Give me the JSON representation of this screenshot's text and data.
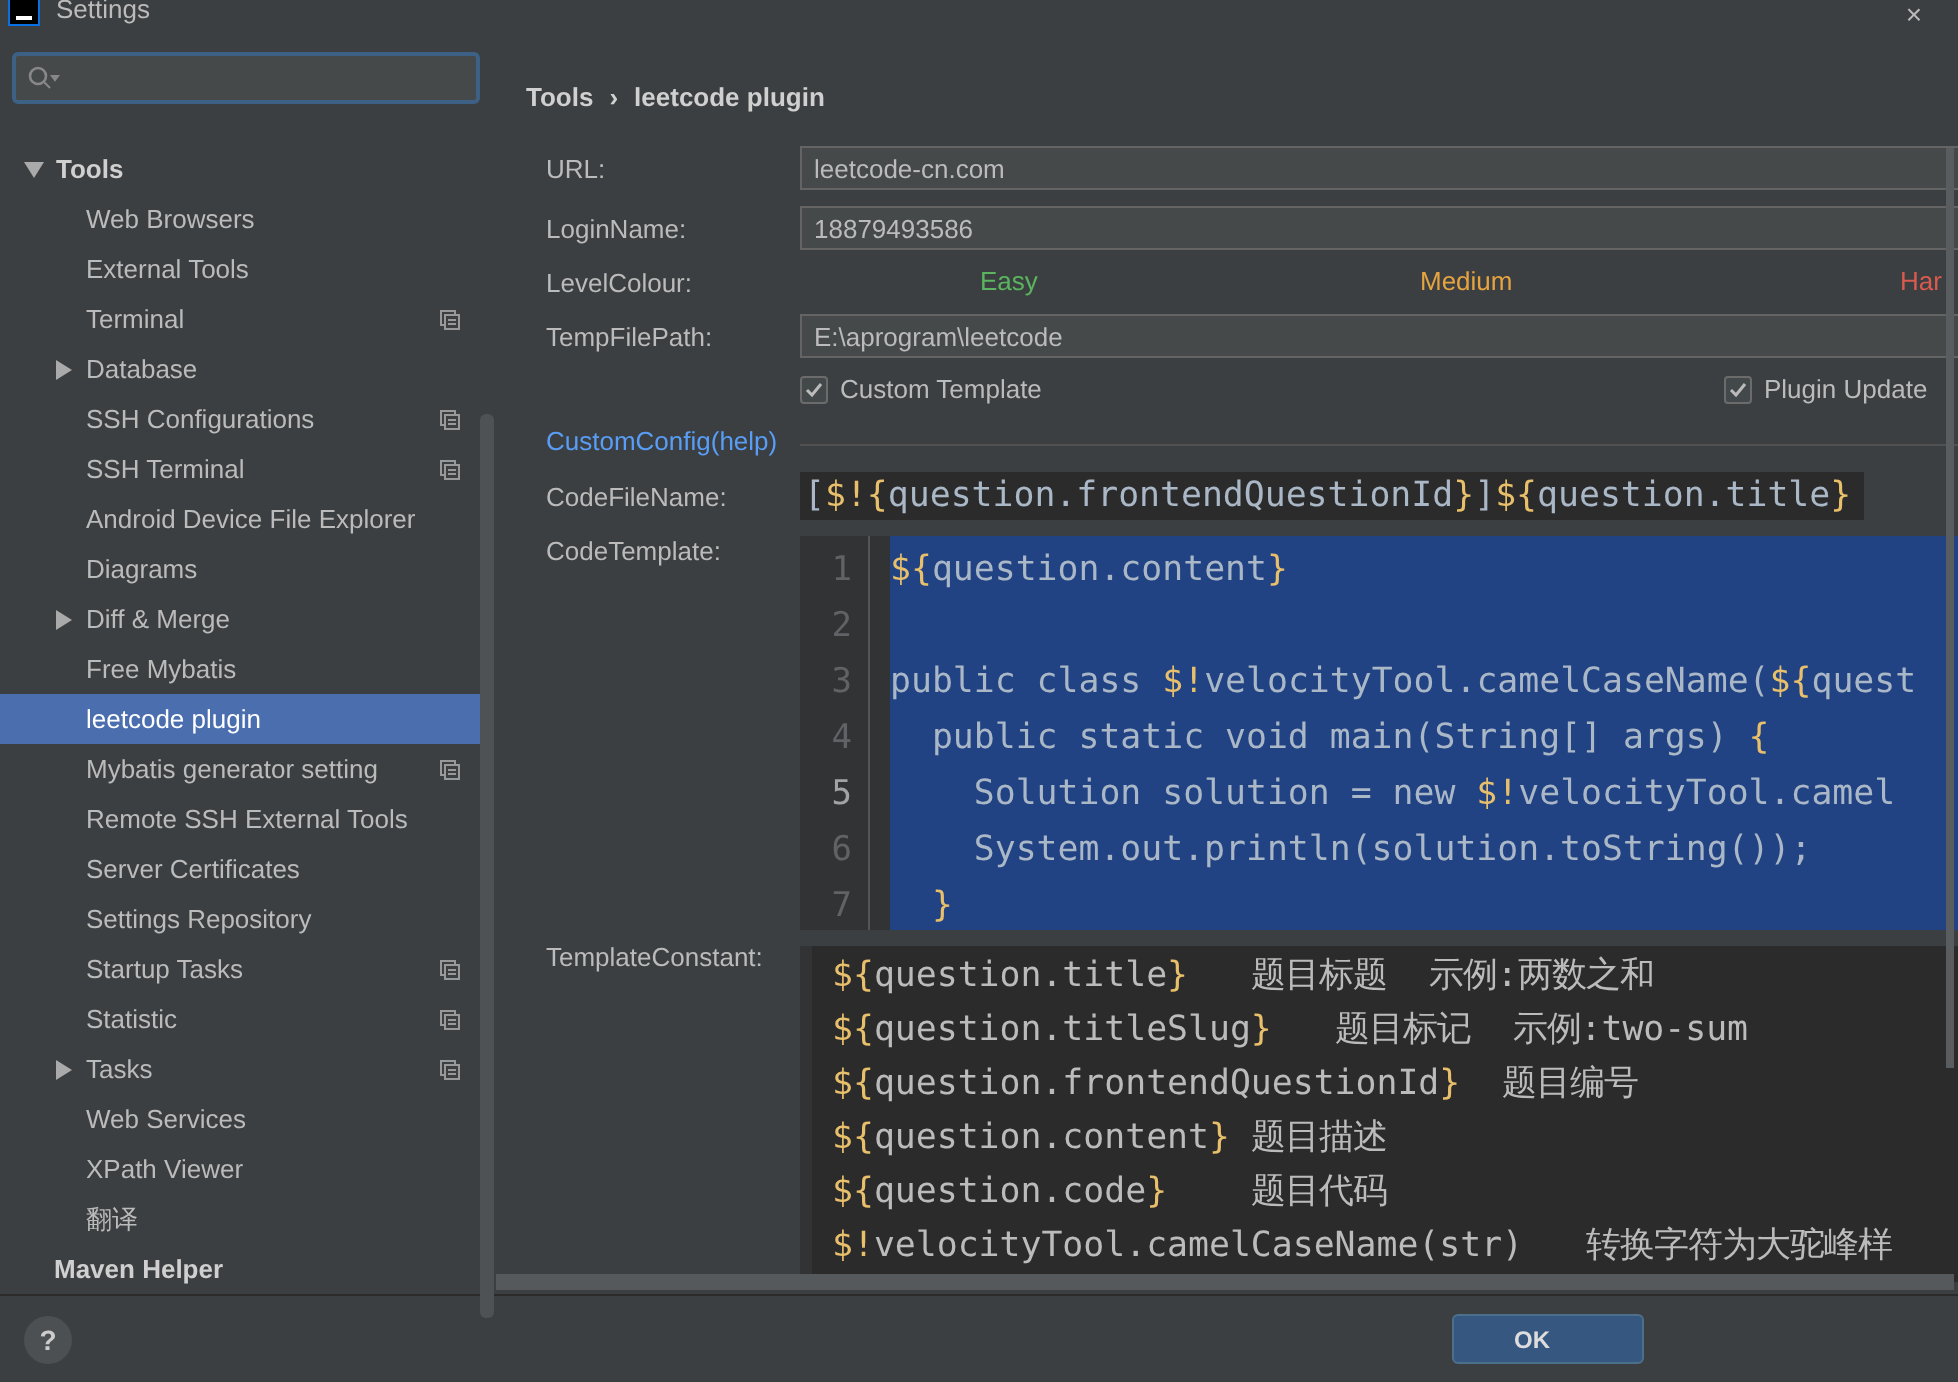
{
  "window": {
    "title": "Settings",
    "close": "×"
  },
  "sidebar": {
    "items": [
      {
        "label": "Tools",
        "expanded": true,
        "children": [
          {
            "label": "Web Browsers",
            "selected": false,
            "project": false
          },
          {
            "label": "External Tools",
            "selected": false,
            "project": false
          },
          {
            "label": "Terminal",
            "selected": false,
            "project": true
          },
          {
            "label": "Database",
            "selected": false,
            "project": false,
            "expanded": false
          },
          {
            "label": "SSH Configurations",
            "selected": false,
            "project": true
          },
          {
            "label": "SSH Terminal",
            "selected": false,
            "project": true
          },
          {
            "label": "Android Device File Explorer",
            "selected": false,
            "project": false
          },
          {
            "label": "Diagrams",
            "selected": false,
            "project": false
          },
          {
            "label": "Diff & Merge",
            "selected": false,
            "project": false,
            "expanded": false
          },
          {
            "label": "Free Mybatis",
            "selected": false,
            "project": false
          },
          {
            "label": "leetcode plugin",
            "selected": true,
            "project": false
          },
          {
            "label": "Mybatis generator setting",
            "selected": false,
            "project": true
          },
          {
            "label": "Remote SSH External Tools",
            "selected": false,
            "project": false
          },
          {
            "label": "Server Certificates",
            "selected": false,
            "project": false
          },
          {
            "label": "Settings Repository",
            "selected": false,
            "project": false
          },
          {
            "label": "Startup Tasks",
            "selected": false,
            "project": true
          },
          {
            "label": "Statistic",
            "selected": false,
            "project": true
          },
          {
            "label": "Tasks",
            "selected": false,
            "project": true,
            "expanded": false
          },
          {
            "label": "Web Services",
            "selected": false,
            "project": false
          },
          {
            "label": "XPath Viewer",
            "selected": false,
            "project": false
          },
          {
            "label": "翻译",
            "selected": false,
            "project": false
          }
        ]
      },
      {
        "label": "Maven Helper"
      }
    ]
  },
  "breadcrumb": [
    "Tools",
    "›",
    "leetcode plugin"
  ],
  "form": {
    "url": {
      "label": "URL:",
      "value": "leetcode-cn.com"
    },
    "login": {
      "label": "LoginName:",
      "value": "18879493586"
    },
    "level_colour": {
      "label": "LevelColour:",
      "levels": [
        {
          "label": "Easy",
          "color": "#5ab55e"
        },
        {
          "label": "Medium",
          "color": "#e5a440"
        },
        {
          "label": "Har",
          "color": "#d95a4f"
        }
      ]
    },
    "temp_path": {
      "label": "TempFilePath:",
      "value": "E:\\aprogram\\leetcode"
    },
    "checkboxes": [
      {
        "label": "Custom Template",
        "checked": true
      },
      {
        "label": "Plugin Update",
        "checked": true
      }
    ],
    "custom_config": "CustomConfig(help)",
    "code_file_name": {
      "label": "CodeFileName:",
      "value": "[$!{question.frontendQuestionId}]${question.title}"
    },
    "code_template": {
      "label": "CodeTemplate:",
      "lines": [
        {
          "number": "1",
          "text": "${question.content}",
          "current": false
        },
        {
          "number": "2",
          "current": false
        },
        {
          "number": "3",
          "text": "public class $!velocityTool.camelCaseName(${quest",
          "current": false
        },
        {
          "number": "4",
          "text": "  public static void main(String[] args) {",
          "current": false
        },
        {
          "number": "5",
          "text": "    Solution solution = new $!velocityTool.camel",
          "current": true
        },
        {
          "number": "6",
          "text": "    System.out.println(solution.toString());",
          "current": false
        },
        {
          "number": "7",
          "text": "  }",
          "current": false
        }
      ]
    },
    "template_constant": {
      "label": "TemplateConstant:",
      "lines": [
        "${question.title}   题目标题  示例:两数之和",
        "${question.titleSlug}   题目标记  示例:two-sum",
        "${question.frontendQuestionId}  题目编号",
        "${question.content} 题目描述",
        "${question.code}    题目代码",
        "$!velocityTool.camelCaseName(str)   转换字符为大驼峰样"
      ]
    }
  },
  "footer": {
    "help": "?",
    "ok": "OK"
  }
}
